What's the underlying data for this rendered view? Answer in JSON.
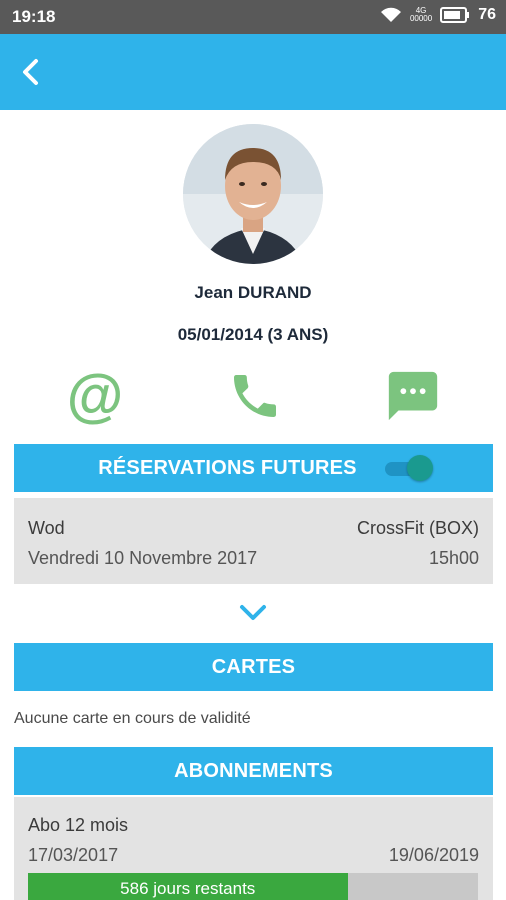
{
  "status_bar": {
    "time": "19:18",
    "network_line1": "4G",
    "network_line2": "00000",
    "battery": "76"
  },
  "profile": {
    "name": "Jean DURAND",
    "birthdate": "05/01/2014 (3 ANS)"
  },
  "contact_actions": {
    "email_glyph": "@"
  },
  "reservations": {
    "title": "RÉSERVATIONS FUTURES",
    "toggle_on": true,
    "items": [
      {
        "activity": "Wod",
        "location": "CrossFit (BOX)",
        "date": "Vendredi 10 Novembre 2017",
        "time": "15h00"
      }
    ]
  },
  "cartes": {
    "title": "CARTES",
    "empty_text": "Aucune carte en cours de validité"
  },
  "abonnements": {
    "title": "ABONNEMENTS",
    "items": [
      {
        "name": "Abo 12 mois",
        "start": "17/03/2017",
        "end": "19/06/2019",
        "remaining_text": "586 jours restants",
        "progress_fraction": 0.71
      }
    ]
  },
  "colors": {
    "primary": "#2fb3ea",
    "action_green": "#7cc47f",
    "progress_green": "#3aa83f"
  }
}
